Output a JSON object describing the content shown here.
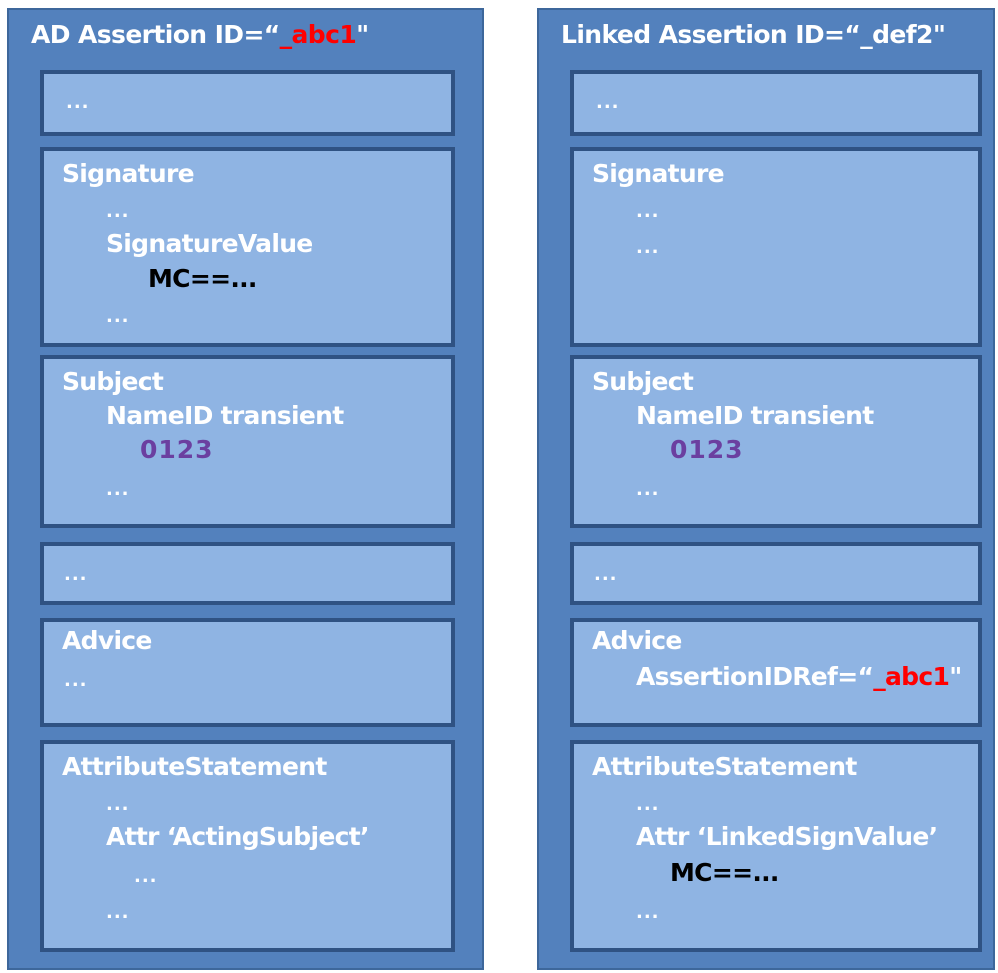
{
  "left": {
    "title_prefix": "AD Assertion  ID=“",
    "title_id": "_abc1",
    "title_suffix": "\"",
    "box1": {
      "text": "..."
    },
    "signature": {
      "header": "Signature",
      "line1": "...",
      "line2": "SignatureValue",
      "line3": "MC==...",
      "line4": "..."
    },
    "subject": {
      "header": "Subject",
      "line1": "NameID transient",
      "line2": "0123",
      "line3": "..."
    },
    "box4": {
      "text": "..."
    },
    "advice": {
      "header": "Advice",
      "line1": "..."
    },
    "attr": {
      "header": "AttributeStatement",
      "line1": "...",
      "line2": "Attr ‘ActingSubject’",
      "line3": "...",
      "line4": "..."
    }
  },
  "right": {
    "title_prefix": "Linked Assertion  ID=“_def2\"",
    "box1": {
      "text": "..."
    },
    "signature": {
      "header": "Signature",
      "line1": "...",
      "line2": "..."
    },
    "subject": {
      "header": "Subject",
      "line1": "NameID transient",
      "line2": "0123",
      "line3": "..."
    },
    "box4": {
      "text": "..."
    },
    "advice": {
      "header": "Advice",
      "line1_prefix": "AssertionIDRef=“",
      "line1_id": "_abc1",
      "line1_suffix": "\""
    },
    "attr": {
      "header": "AttributeStatement",
      "line1": "...",
      "line2": "Attr ‘LinkedSignValue’",
      "line3": "MC==..."
    }
  },
  "colors": {
    "column_bg": "#5381bd",
    "box_bg": "#8fb4e3",
    "box_border": "#2f5283",
    "highlight_red": "#ff0000",
    "value_purple": "#6b3fa0"
  }
}
